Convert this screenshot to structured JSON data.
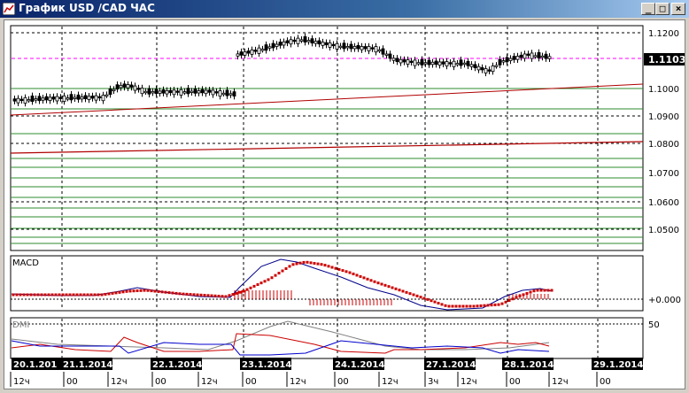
{
  "window": {
    "title": "График USD /CAD  ЧАС",
    "min_glyph": "_",
    "max_glyph": "□",
    "close_glyph": "×"
  },
  "price_axis": {
    "labels": [
      "1.1200",
      "1.1000",
      "1.0900",
      "1.0800",
      "1.0700",
      "1.0600",
      "1.0500"
    ],
    "current_price": "1.1103"
  },
  "macd": {
    "title": "MACD",
    "zero_label": "+0.000"
  },
  "dmi": {
    "title": "DMI",
    "level_label": "50"
  },
  "time_axis": {
    "dates": [
      "20.1.201",
      "21.1.2014",
      "22.1.2014",
      "23.1.2014",
      "24.1.2014",
      "27.1.2014",
      "28.1.2014",
      "29.1.2014"
    ],
    "hours": [
      "12ч",
      "00",
      "12ч",
      "00",
      "12ч",
      "00",
      "12ч",
      "00",
      "12ч",
      "3ч",
      "12ч",
      "00",
      "12ч",
      "00"
    ]
  },
  "colors": {
    "candle": "#000000",
    "trendline": "#c00000",
    "support_line": "#008000",
    "current_price_line": "#ff00ff",
    "macd_line": "#00008b",
    "signal_dots": "#cc0000",
    "dmi_plus": "#cc0000",
    "dmi_minus": "#0000cc",
    "adx": "#808080"
  }
}
